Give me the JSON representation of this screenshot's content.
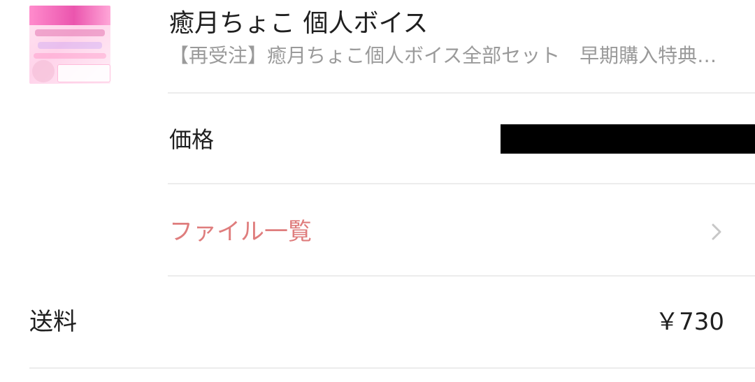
{
  "item": {
    "title": "癒月ちょこ 個人ボイス",
    "subtitle": "【再受注】癒月ちょこ個人ボイス全部セット　早期購入特典…"
  },
  "rows": {
    "price_label": "価格",
    "file_list_label": "ファイル一覧",
    "shipping_label": "送料",
    "shipping_value": "￥730"
  },
  "icons": {
    "thumbnail": "product-thumbnail",
    "chevron": "chevron-right-icon"
  },
  "colors": {
    "file_link": "#df7d7d",
    "subtitle": "#9a9a9a",
    "divider": "#ececec",
    "redaction": "#000000"
  }
}
